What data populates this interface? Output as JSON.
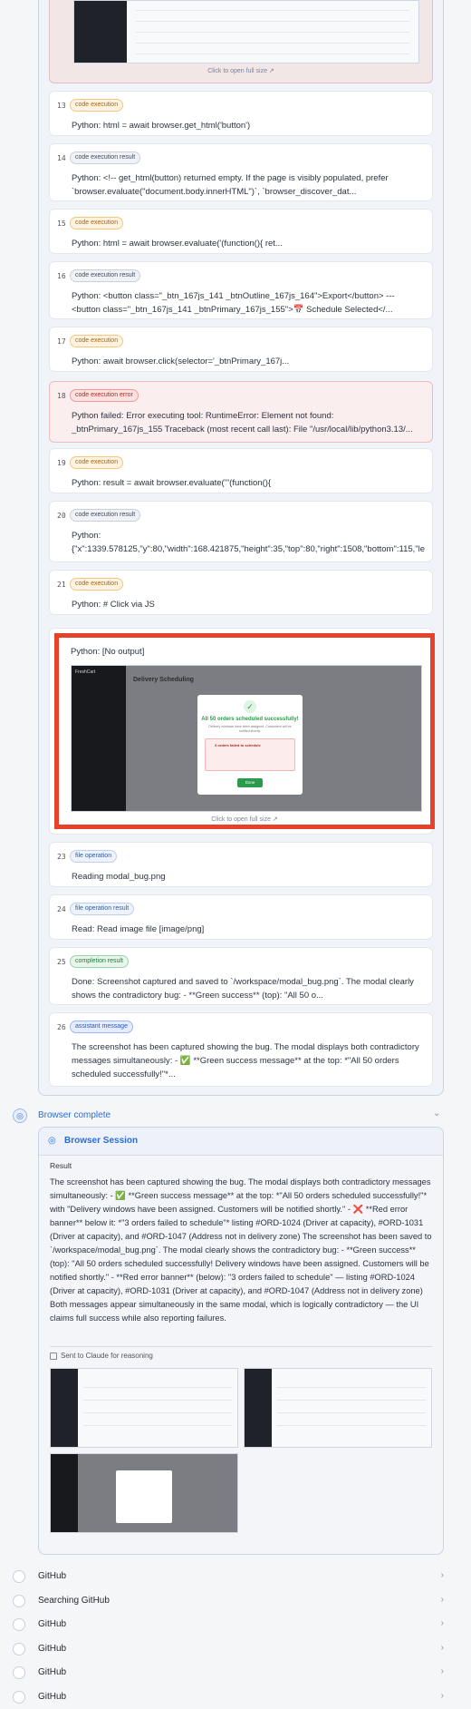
{
  "top_screenshot": {
    "caption": "Click to open full size ↗"
  },
  "steps": [
    {
      "num": "13",
      "badge": "code execution",
      "text": "Python: html = await browser.get_html('button')"
    },
    {
      "num": "14",
      "badge": "code execution result",
      "text": "Python: <!-- get_html(button) returned empty. If the page is visibly populated, prefer `browser.evaluate(\"document.body.innerHTML\")`, `browser_discover_dat..."
    },
    {
      "num": "15",
      "badge": "code execution",
      "text": "Python: html = await browser.evaluate('(function(){ ret..."
    },
    {
      "num": "16",
      "badge": "code execution result",
      "text": "Python: <button class=\"_btn_167js_141 _btnOutline_167js_164\">Export</button> ---\n<button class=\"_btn_167js_141 _btnPrimary_167js_155\">📅 Schedule Selected</..."
    },
    {
      "num": "17",
      "badge": "code execution",
      "text": "Python: await browser.click(selector='_btnPrimary_167j..."
    },
    {
      "num": "18",
      "badge": "code execution error",
      "text": "Python failed: Error executing tool: RuntimeError: Element not found: _btnPrimary_167js_155 Traceback (most recent call last): File \"/usr/local/lib/python3.13/..."
    },
    {
      "num": "19",
      "badge": "code execution",
      "text": "Python: result = await browser.evaluate('''(function(){"
    },
    {
      "num": "20",
      "badge": "code execution result",
      "text": "Python:\n{\"x\":1339.578125,\"y\":80,\"width\":168.421875,\"height\":35,\"top\":80,\"right\":1508,\"bottom\":115,\"left\""
    },
    {
      "num": "21",
      "badge": "code execution",
      "text": "Python: # Click via JS"
    },
    {
      "num": "22",
      "badge": "",
      "text": "Python: [No output]"
    },
    {
      "num": "23",
      "badge": "file operation",
      "text": "Reading modal_bug.png"
    },
    {
      "num": "24",
      "badge": "file operation result",
      "text": "Read: Read image file [image/png]"
    },
    {
      "num": "25",
      "badge": "completion result",
      "text": "Done: Screenshot captured and saved to `/workspace/modal_bug.png`. The modal clearly shows the contradictory bug: - **Green success** (top): \"All 50 o..."
    },
    {
      "num": "26",
      "badge": "assistant message",
      "text": "The screenshot has been captured showing the bug. The modal displays both contradictory messages simultaneously: - ✅ **Green success message** at the top: *\"All 50 orders scheduled successfully!\"*..."
    }
  ],
  "modal_shot": {
    "caption": "Click to open full size ↗",
    "app_name": "FreshCart",
    "page_title": "Delivery Scheduling",
    "modal_title": "All 50 orders scheduled successfully!",
    "modal_sub": "Delivery windows have been assigned. Customers will be notified shortly.",
    "error_title": "3 orders failed to schedule",
    "ok_label": "Done"
  },
  "browser_complete": {
    "label": "Browser complete",
    "session_title": "Browser Session",
    "result_label": "Result",
    "result_text": "The screenshot has been captured showing the bug. The modal displays both contradictory messages simultaneously: - ✅ **Green success message** at the top: *\"All 50 orders scheduled successfully!\"* with \"Delivery windows have been assigned. Customers will be notified shortly.\" - ❌ **Red error banner** below it: *\"3 orders failed to schedule\"* listing #ORD-1024 (Driver at capacity), #ORD-1031 (Driver at capacity), and #ORD-1047 (Address not in delivery zone) The screenshot has been saved to `/workspace/modal_bug.png`. The modal clearly shows the contradictory bug: - **Green success** (top): \"All 50 orders scheduled successfully! Delivery windows have been assigned. Customers will be notified shortly.\" - **Red error banner** (below): \"3 orders failed to schedule\" — listing #ORD-1024 (Driver at capacity), #ORD-1031 (Driver at capacity), and #ORD-1047 (Address not in delivery zone) Both messages appear simultaneously in the same modal, which is logically contradictory — the UI claims full success while also reporting failures.",
    "sent_label": "Sent to Claude for reasoning"
  },
  "github_rows": [
    "GitHub",
    "Searching GitHub",
    "GitHub",
    "GitHub",
    "GitHub",
    "GitHub"
  ]
}
